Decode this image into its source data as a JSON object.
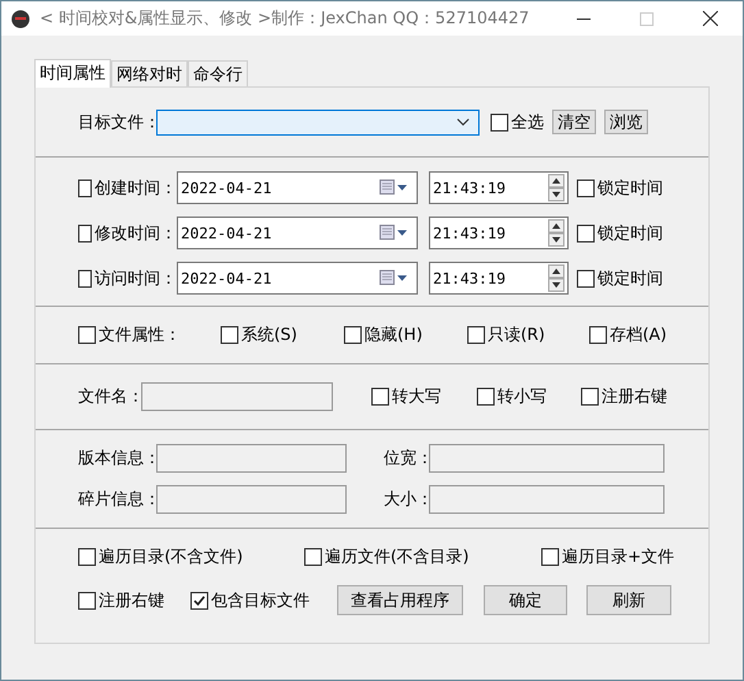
{
  "window": {
    "title": "< 时间校对&属性显示、修改 >制作：JexChan  QQ：527104427"
  },
  "tabs": [
    {
      "label": "时间属性",
      "selected": true
    },
    {
      "label": "网络对时",
      "selected": false
    },
    {
      "label": "命令行",
      "selected": false
    }
  ],
  "target": {
    "label": "目标文件：",
    "select_all": {
      "label": "全选",
      "checked": false
    },
    "buttons": [
      "清空",
      "浏览"
    ]
  },
  "times": [
    {
      "label": "创建时间：",
      "checked": false,
      "date": "2022-04-21",
      "time": "21:43:19",
      "lock": {
        "label": "锁定时间",
        "checked": false
      }
    },
    {
      "label": "修改时间：",
      "checked": false,
      "date": "2022-04-21",
      "time": "21:43:19",
      "lock": {
        "label": "锁定时间",
        "checked": false
      }
    },
    {
      "label": "访问时间：",
      "checked": false,
      "date": "2022-04-21",
      "time": "21:43:19",
      "lock": {
        "label": "锁定时间",
        "checked": false
      }
    }
  ],
  "attributes": [
    {
      "label": "文件属性：",
      "checked": false
    },
    {
      "label": "系统(S)",
      "checked": false
    },
    {
      "label": "隐藏(H)",
      "checked": false
    },
    {
      "label": "只读(R)",
      "checked": false
    },
    {
      "label": "存档(A)",
      "checked": false
    }
  ],
  "filename": {
    "label": "文件名：",
    "options": [
      {
        "label": "转大写",
        "checked": false
      },
      {
        "label": "转小写",
        "checked": false
      },
      {
        "label": "注册右键",
        "checked": false
      }
    ]
  },
  "info": [
    {
      "label": "版本信息："
    },
    {
      "label": "位宽："
    },
    {
      "label": "碎片信息："
    },
    {
      "label": "大小："
    }
  ],
  "traverse": [
    {
      "label": "遍历目录(不含文件)",
      "checked": false
    },
    {
      "label": "遍历文件(不含目录)",
      "checked": false
    },
    {
      "label": "遍历目录+文件",
      "checked": false
    }
  ],
  "extras": [
    {
      "label": "注册右键",
      "checked": false
    },
    {
      "label": "包含目标文件",
      "checked": true
    }
  ],
  "buttons": [
    "查看占用程序",
    "确定",
    "刷新"
  ]
}
